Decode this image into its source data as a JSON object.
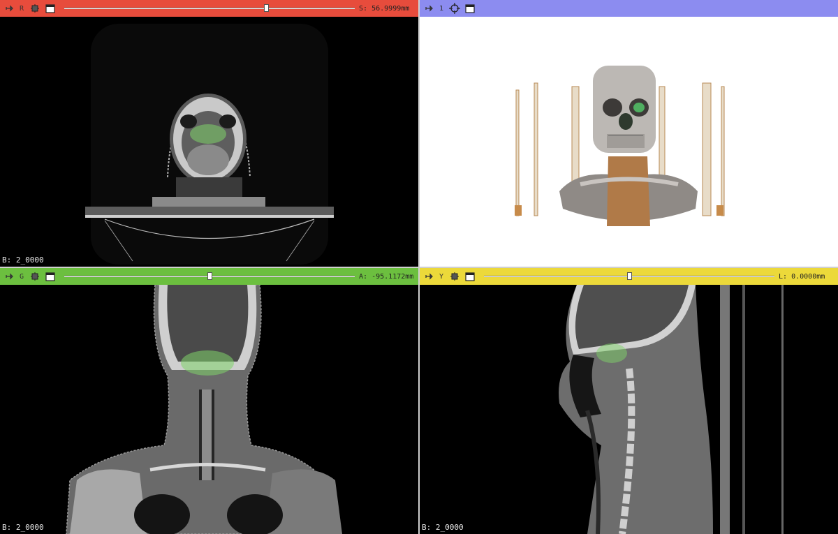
{
  "views": {
    "red": {
      "letter": "R",
      "readout": "S: 56.9999mm",
      "slider_fraction": 0.7,
      "corner": "B: 2_0000",
      "color": "#e74c3c"
    },
    "threed": {
      "letter": "1",
      "color": "#8c8cf0"
    },
    "green": {
      "letter": "G",
      "readout": "A: -95.1172mm",
      "slider_fraction": 0.5,
      "corner": "B: 2_0000",
      "color": "#6cbf3f"
    },
    "yellow": {
      "letter": "Y",
      "readout": "L: 0.0000mm",
      "slider_fraction": 0.5,
      "corner": "B: 2_0000",
      "color": "#ecd93a"
    }
  },
  "icons": [
    "pin-icon",
    "link-icon",
    "crosshair-icon",
    "window-icon"
  ],
  "segmentation_color": "#7fd36a"
}
